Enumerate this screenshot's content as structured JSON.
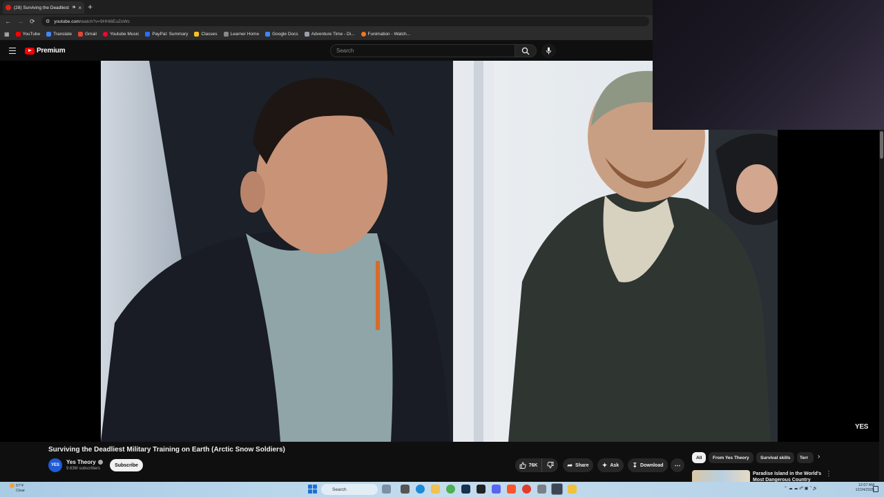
{
  "browser": {
    "tab_title": "(28) Surviving the Deadliest",
    "new_tab": "+",
    "tab_close": "×",
    "url_host": "youtube.com",
    "url_path": "/watch?v=9HHi6EuZoWc",
    "bookmarks": [
      {
        "label": "YouTube",
        "color": "#ff0000"
      },
      {
        "label": "Translate",
        "color": "#4285f4"
      },
      {
        "label": "Gmail",
        "color": "#ea4335"
      },
      {
        "label": "Youtube Music",
        "color": "#ff0033"
      },
      {
        "label": "PayPal: Summary",
        "color": "#2a6df4"
      },
      {
        "label": "Classes",
        "color": "#f6c026"
      },
      {
        "label": "Learner Home",
        "color": "#888888"
      },
      {
        "label": "Google Docs",
        "color": "#4285f4"
      },
      {
        "label": "Adventure Time - Di...",
        "color": "#9aa0a6"
      },
      {
        "label": "Funimation - Watch...",
        "color": "#f47521"
      }
    ]
  },
  "youtube": {
    "logo_text": "Premium",
    "search_placeholder": "Search",
    "watermark": "YES",
    "video_title": "Surviving the Deadliest Military Training on Earth (Arctic Snow Soldiers)",
    "channel_avatar_text": "YES",
    "channel_name": "Yes Theory",
    "subscribers": "9.63M subscribers",
    "subscribe_label": "Subscribe",
    "likes": "76K",
    "share_label": "Share",
    "ask_label": "Ask",
    "download_label": "Download",
    "chips": [
      "All",
      "From Yes Theory",
      "Survival skills",
      "Terr"
    ],
    "recommended_title": "Paradise Island in the World's Most Dangerous Country"
  },
  "taskbar": {
    "weather_temp": "57°F",
    "weather_desc": "Clear",
    "search_label": "Search",
    "time": "12:07 AM",
    "date": "12/24/2025"
  },
  "colors": {
    "youtube_red": "#ff0000",
    "background": "#0f0f0f",
    "taskbar": "#c3dcee"
  }
}
